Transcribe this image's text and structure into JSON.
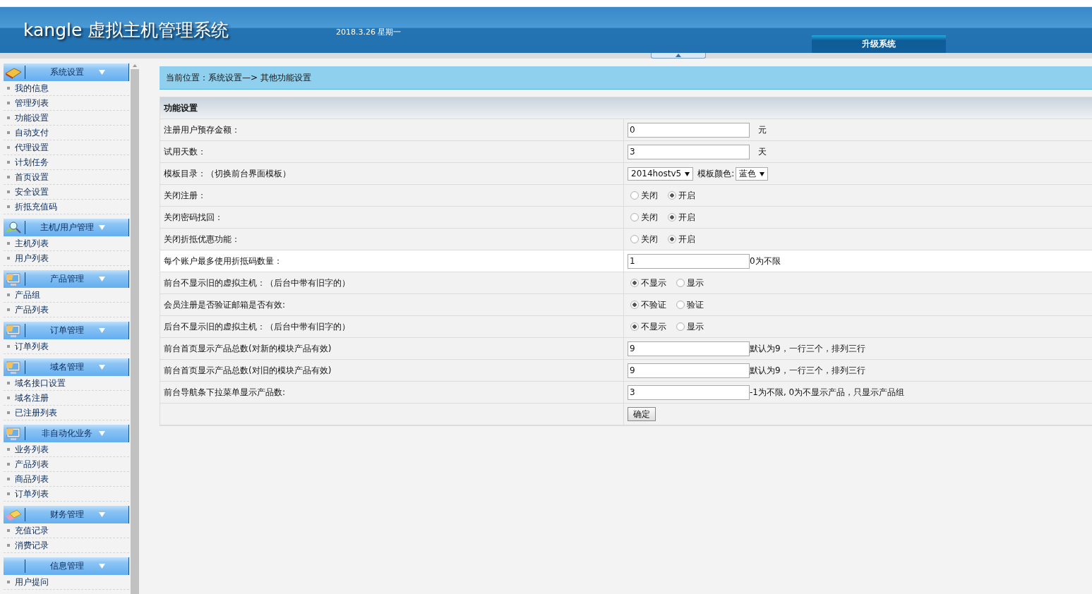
{
  "header": {
    "title": "kangle 虚拟主机管理系统",
    "date": "2018.3.26 星期一",
    "upgrade_button": "升级系统"
  },
  "sidebar": {
    "groups": [
      {
        "title": "系统设置",
        "items": [
          "我的信息",
          "管理列表",
          "功能设置",
          "自动支付",
          "代理设置",
          "计划任务",
          "首页设置",
          "安全设置",
          "折抵充值码"
        ]
      },
      {
        "title": "主机/用户管理",
        "items": [
          "主机列表",
          "用户列表"
        ]
      },
      {
        "title": "产品管理",
        "items": [
          "产品组",
          "产品列表"
        ]
      },
      {
        "title": "订单管理",
        "items": [
          "订单列表"
        ]
      },
      {
        "title": "域名管理",
        "items": [
          "域名接口设置",
          "域名注册",
          "已注册列表"
        ]
      },
      {
        "title": "非自动化业务",
        "items": [
          "业务列表",
          "产品列表",
          "商品列表",
          "订单列表"
        ]
      },
      {
        "title": "财务管理",
        "items": [
          "充值记录",
          "消费记录"
        ]
      },
      {
        "title": "信息管理",
        "items": [
          "用户提问"
        ]
      }
    ]
  },
  "breadcrumb": "当前位置：系统设置—> 其他功能设置",
  "panel": {
    "title": "功能设置",
    "rows": [
      {
        "kind": "input",
        "label": "注册用户预存金额：",
        "value": "0",
        "suffix": "元",
        "highlighted": false
      },
      {
        "kind": "input",
        "label": "试用天数：",
        "value": "3",
        "suffix": "天",
        "highlighted": false
      },
      {
        "kind": "select",
        "label": "模板目录：（切换前台界面模板）",
        "selects": [
          {
            "value": "2014hostv5"
          },
          {
            "caption": "模板颜色:",
            "value": "蓝色"
          }
        ],
        "highlighted": false
      },
      {
        "kind": "radio",
        "label": "关闭注册：",
        "options": [
          {
            "label": "关闭",
            "selected": false
          },
          {
            "label": "开启",
            "selected": true
          }
        ],
        "highlighted": false
      },
      {
        "kind": "radio",
        "label": "关闭密码找回：",
        "options": [
          {
            "label": "关闭",
            "selected": false
          },
          {
            "label": "开启",
            "selected": true
          }
        ],
        "highlighted": false
      },
      {
        "kind": "radio",
        "label": "关闭折抵优惠功能：",
        "options": [
          {
            "label": "关闭",
            "selected": false
          },
          {
            "label": "开启",
            "selected": true
          }
        ],
        "highlighted": false
      },
      {
        "kind": "input",
        "label": "每个账户最多使用折抵码数量：",
        "value": "1",
        "suffix": "0为不限",
        "highlighted": true
      },
      {
        "kind": "radio",
        "label": "前台不显示旧的虚拟主机：（后台中带有旧字的）",
        "options": [
          {
            "label": "不显示",
            "selected": true
          },
          {
            "label": "显示",
            "selected": false
          }
        ],
        "highlighted": false
      },
      {
        "kind": "radio",
        "label": "会员注册是否验证邮箱是否有效:",
        "options": [
          {
            "label": "不验证",
            "selected": true
          },
          {
            "label": "验证",
            "selected": false
          }
        ],
        "highlighted": false
      },
      {
        "kind": "radio",
        "label": "后台不显示旧的虚拟主机：（后台中带有旧字的）",
        "options": [
          {
            "label": "不显示",
            "selected": true
          },
          {
            "label": "显示",
            "selected": false
          }
        ],
        "highlighted": false
      },
      {
        "kind": "input",
        "label": "前台首页显示产品总数(对新的模块产品有效)",
        "value": "9",
        "suffix": "默认为9，一行三个，排列三行",
        "highlighted": false
      },
      {
        "kind": "input",
        "label": "前台首页显示产品总数(对旧的模块产品有效)",
        "value": "9",
        "suffix": "默认为9，一行三个，排列三行",
        "highlighted": false
      },
      {
        "kind": "input",
        "label": "前台导航条下拉菜单显示产品数:",
        "value": "3",
        "suffix": "-1为不限, 0为不显示产品，只显示产品组",
        "highlighted": false
      },
      {
        "kind": "button",
        "label": "",
        "button": "确定",
        "highlighted": false
      }
    ]
  }
}
